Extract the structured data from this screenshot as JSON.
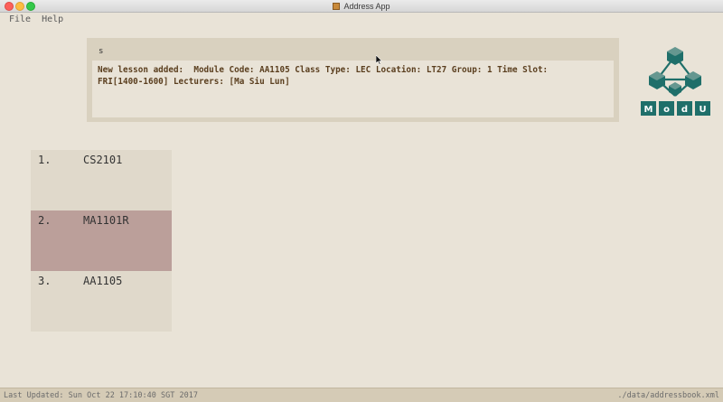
{
  "window": {
    "title": "Address App"
  },
  "menu": {
    "file": "File",
    "help": "Help"
  },
  "command": {
    "value": "s"
  },
  "result": {
    "text": "New lesson added:  Module Code: AA1105 Class Type: LEC Location: LT27 Group: 1 Time Slot:\nFRI[1400-1600] Lecturers: [Ma Siu Lun]"
  },
  "logo": {
    "letters": [
      "M",
      "o",
      "d",
      "U"
    ],
    "color": "#1f6f6a"
  },
  "modules": [
    {
      "index": "1.",
      "code": "CS2101"
    },
    {
      "index": "2.",
      "code": "MA1101R",
      "selected": true
    },
    {
      "index": "3.",
      "code": "AA1105"
    }
  ],
  "status": {
    "last_updated": "Last Updated: Sun Oct 22 17:10:40 SGT 2017",
    "file_path": "./data/addressbook.xml"
  },
  "colors": {
    "background": "#e9e3d7",
    "selected": "#bb9f9a",
    "result_text": "#5a3e1e"
  }
}
